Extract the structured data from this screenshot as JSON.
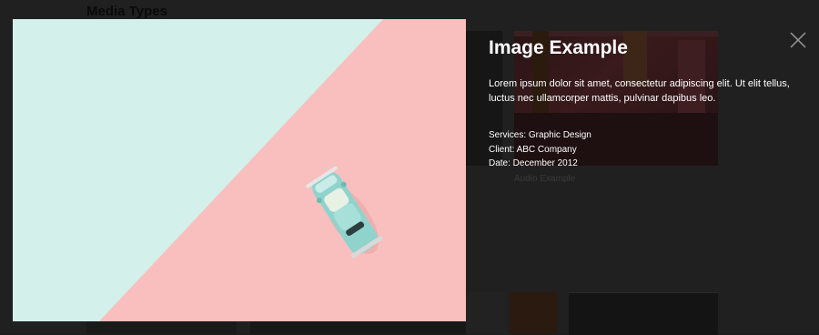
{
  "background_page": {
    "heading": "Media Types",
    "thumbnail_caption": "Audio Example"
  },
  "lightbox": {
    "title": "Image Example",
    "description": "Lorem ipsum dolor sit amet, consectetur adipiscing elit. Ut elit tellus, luctus nec ullamcorper mattis, pulvinar dapibus leo.",
    "meta": [
      {
        "text": "Services: Graphic Design"
      },
      {
        "text": "Client: ABC Company"
      },
      {
        "text": "Date: December 2012"
      }
    ],
    "close_icon": "close-x-icon",
    "image_colors": {
      "mint": "#d3f0ea",
      "pink": "#f8bfbe",
      "car": "#8fd3cc"
    }
  }
}
